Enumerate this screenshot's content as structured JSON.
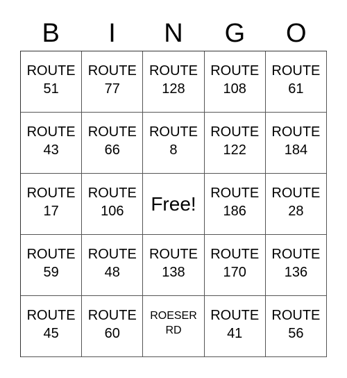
{
  "header": [
    "B",
    "I",
    "N",
    "G",
    "O"
  ],
  "cells": [
    [
      "ROUTE\n51",
      "ROUTE\n77",
      "ROUTE\n128",
      "ROUTE\n108",
      "ROUTE\n61"
    ],
    [
      "ROUTE\n43",
      "ROUTE\n66",
      "ROUTE\n8",
      "ROUTE\n122",
      "ROUTE\n184"
    ],
    [
      "ROUTE\n17",
      "ROUTE\n106",
      "Free!",
      "ROUTE\n186",
      "ROUTE\n28"
    ],
    [
      "ROUTE\n59",
      "ROUTE\n48",
      "ROUTE\n138",
      "ROUTE\n170",
      "ROUTE\n136"
    ],
    [
      "ROUTE\n45",
      "ROUTE\n60",
      "ROESER\nRD",
      "ROUTE\n41",
      "ROUTE\n56"
    ]
  ]
}
